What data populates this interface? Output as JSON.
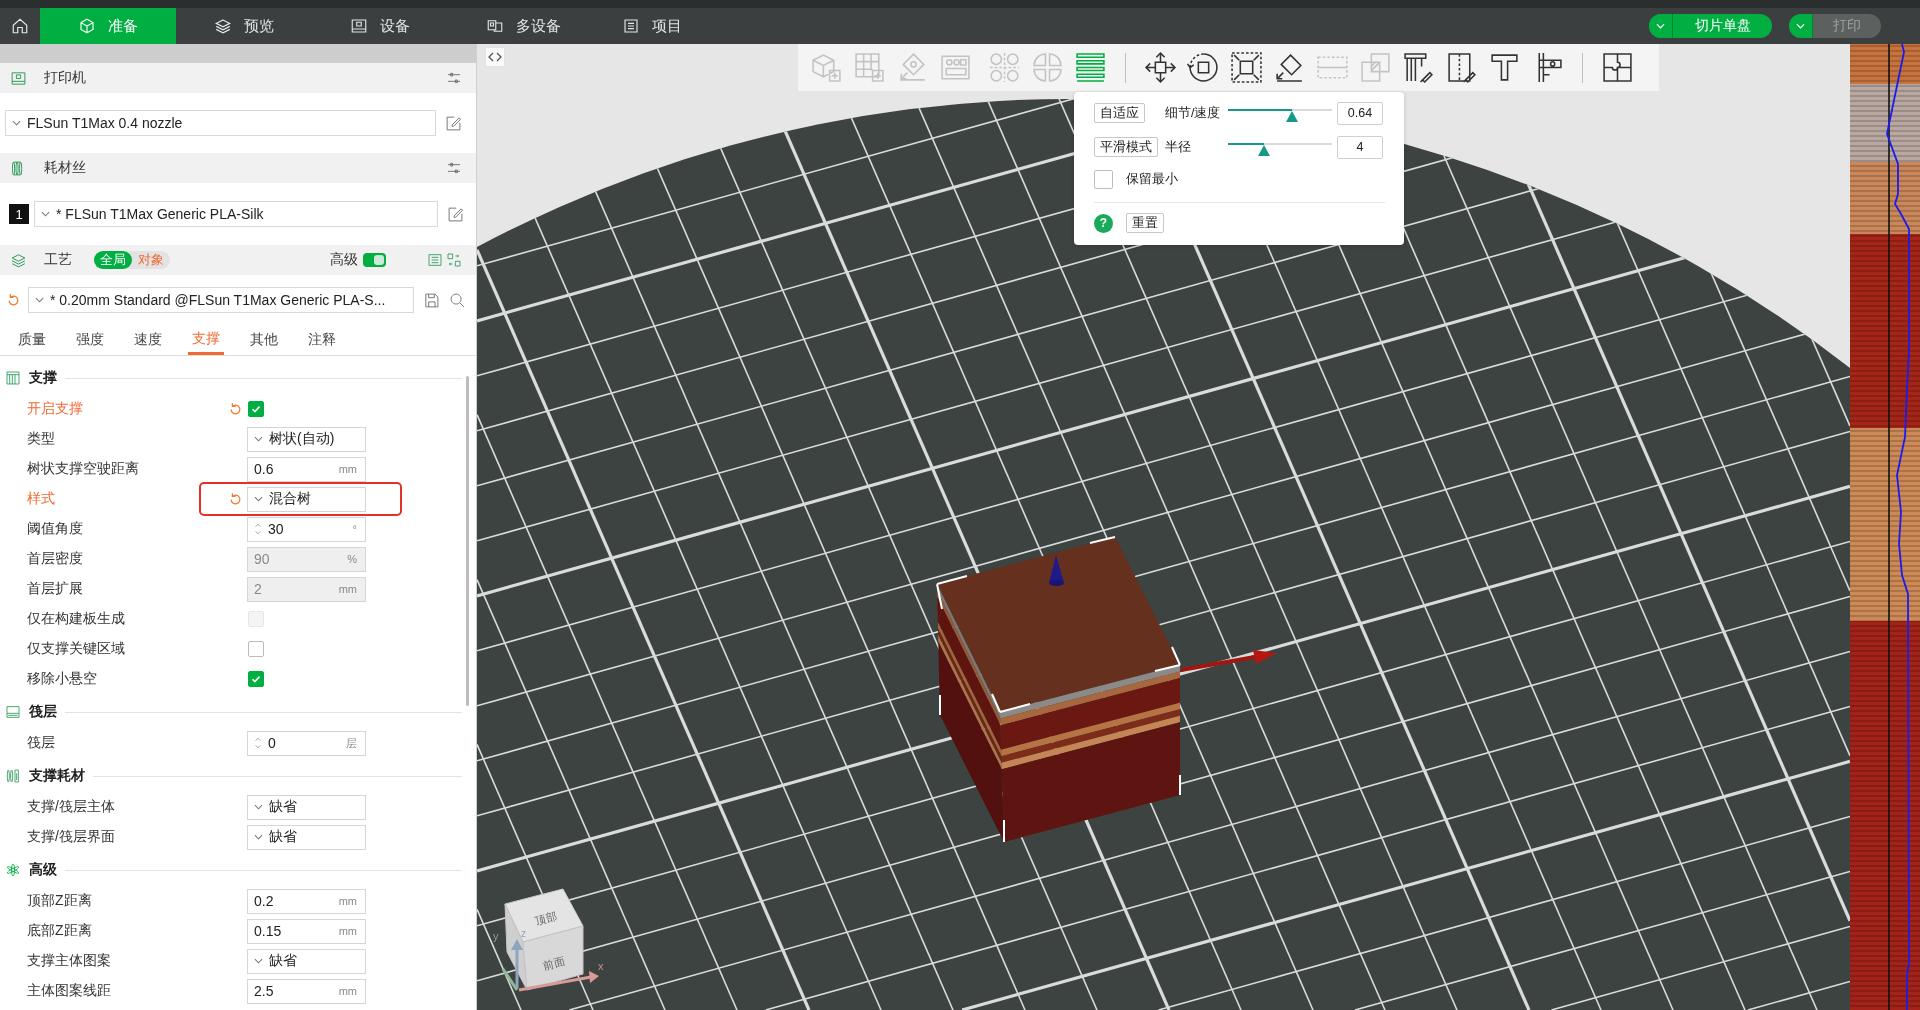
{
  "top_bar": {
    "tabs": [
      {
        "label": "准备",
        "selected": true
      },
      {
        "label": "预览",
        "selected": false
      },
      {
        "label": "设备",
        "selected": false
      },
      {
        "label": "多设备",
        "selected": false
      },
      {
        "label": "项目",
        "selected": false
      }
    ],
    "slice_button": {
      "label": "切片单盘",
      "disabled": false
    },
    "print_button": {
      "label": "打印",
      "disabled": true
    }
  },
  "sidebar": {
    "printer": {
      "title": "打印机",
      "preset": "FLSun T1Max 0.4 nozzle"
    },
    "filament": {
      "title": "耗材丝",
      "slots": [
        {
          "number": "1",
          "preset": "* FLSun T1Max Generic PLA-Silk"
        }
      ]
    },
    "process": {
      "title": "工艺",
      "scopes": [
        {
          "label": "全局",
          "selected": true
        },
        {
          "label": "对象",
          "selected": false
        }
      ],
      "advanced": {
        "label": "高级",
        "on": true
      },
      "modified": true,
      "preset": "* 0.20mm Standard @FLSun T1Max Generic PLA-S...",
      "tabs": [
        {
          "label": "质量",
          "selected": false
        },
        {
          "label": "强度",
          "selected": false
        },
        {
          "label": "速度",
          "selected": false
        },
        {
          "label": "支撑",
          "selected": true
        },
        {
          "label": "其他",
          "selected": false
        },
        {
          "label": "注释",
          "selected": false
        }
      ]
    },
    "groups": [
      {
        "title": "支撑",
        "rows": [
          {
            "label": "开启支撑",
            "kind": "checkbox",
            "checked": true,
            "modified": true,
            "disabled": false,
            "highlighted": false
          },
          {
            "label": "类型",
            "kind": "select",
            "value": "树状(自动)",
            "modified": false,
            "disabled": false,
            "highlighted": false
          },
          {
            "label": "树状支撑空驶距离",
            "kind": "number",
            "value": "0.6",
            "unit": "mm",
            "modified": false,
            "disabled": false,
            "highlighted": false
          },
          {
            "label": "样式",
            "kind": "select",
            "value": "混合树",
            "modified": true,
            "disabled": false,
            "highlighted": true
          },
          {
            "label": "阈值角度",
            "kind": "spin",
            "value": "30",
            "unit": "°",
            "modified": false,
            "disabled": false,
            "highlighted": false
          },
          {
            "label": "首层密度",
            "kind": "number",
            "value": "90",
            "unit": "%",
            "modified": false,
            "disabled": true,
            "highlighted": false
          },
          {
            "label": "首层扩展",
            "kind": "number",
            "value": "2",
            "unit": "mm",
            "modified": false,
            "disabled": true,
            "highlighted": false
          },
          {
            "label": "仅在构建板生成",
            "kind": "checkbox",
            "checked": false,
            "modified": false,
            "disabled": true,
            "highlighted": false
          },
          {
            "label": "仅支撑关键区域",
            "kind": "checkbox",
            "checked": false,
            "modified": false,
            "disabled": false,
            "highlighted": false
          },
          {
            "label": "移除小悬空",
            "kind": "checkbox",
            "checked": true,
            "modified": false,
            "disabled": false,
            "highlighted": false
          }
        ]
      },
      {
        "title": "筏层",
        "rows": [
          {
            "label": "筏层",
            "kind": "spin",
            "value": "0",
            "unit": "层",
            "modified": false,
            "disabled": false,
            "highlighted": false
          }
        ]
      },
      {
        "title": "支撑耗材",
        "rows": [
          {
            "label": "支撑/筏层主体",
            "kind": "select",
            "value": "缺省",
            "modified": false,
            "disabled": false,
            "highlighted": false
          },
          {
            "label": "支撑/筏层界面",
            "kind": "select",
            "value": "缺省",
            "modified": false,
            "disabled": false,
            "highlighted": false
          }
        ]
      },
      {
        "title": "高级",
        "rows": [
          {
            "label": "顶部Z距离",
            "kind": "number",
            "value": "0.2",
            "unit": "mm",
            "modified": false,
            "disabled": false,
            "highlighted": false
          },
          {
            "label": "底部Z距离",
            "kind": "number",
            "value": "0.15",
            "unit": "mm",
            "modified": false,
            "disabled": false,
            "highlighted": false
          },
          {
            "label": "支撑主体图案",
            "kind": "select",
            "value": "缺省",
            "modified": false,
            "disabled": false,
            "highlighted": false
          },
          {
            "label": "主体图案线距",
            "kind": "number",
            "value": "2.5",
            "unit": "mm",
            "modified": false,
            "disabled": false,
            "highlighted": false
          }
        ]
      }
    ]
  },
  "viewport": {
    "toolbar": {
      "groups": [
        {
          "tools": [
            {
              "disabled": true,
              "selected": false
            },
            {
              "disabled": true,
              "selected": false
            },
            {
              "disabled": true,
              "selected": false
            },
            {
              "disabled": true,
              "selected": false
            },
            {
              "disabled": true,
              "selected": false
            },
            {
              "disabled": true,
              "selected": false
            },
            {
              "disabled": false,
              "selected": true
            }
          ]
        },
        {
          "tools": [
            {
              "disabled": false,
              "selected": false
            },
            {
              "disabled": false,
              "selected": false
            },
            {
              "disabled": false,
              "selected": false
            },
            {
              "disabled": false,
              "selected": false
            },
            {
              "disabled": true,
              "selected": false
            },
            {
              "disabled": true,
              "selected": false
            },
            {
              "disabled": false,
              "selected": false
            },
            {
              "disabled": false,
              "selected": false
            },
            {
              "disabled": false,
              "selected": false
            },
            {
              "disabled": false,
              "selected": false
            }
          ]
        },
        {
          "tools": [
            {
              "disabled": false,
              "selected": false
            }
          ]
        }
      ]
    },
    "layer_panel": {
      "rows": [
        {
          "button": "自适应",
          "label": "细节/速度",
          "level": 0.62,
          "value": "0.64"
        },
        {
          "button": "平滑模式",
          "label": "半径",
          "level": 0.35,
          "value": "4"
        }
      ],
      "keep_min": {
        "label": "保留最小",
        "checked": false
      },
      "help": "?",
      "reset": "重置"
    },
    "view_cube": {
      "faces": [
        "顶部",
        "前面"
      ],
      "axes": [
        "x",
        "y",
        "z"
      ]
    }
  }
}
